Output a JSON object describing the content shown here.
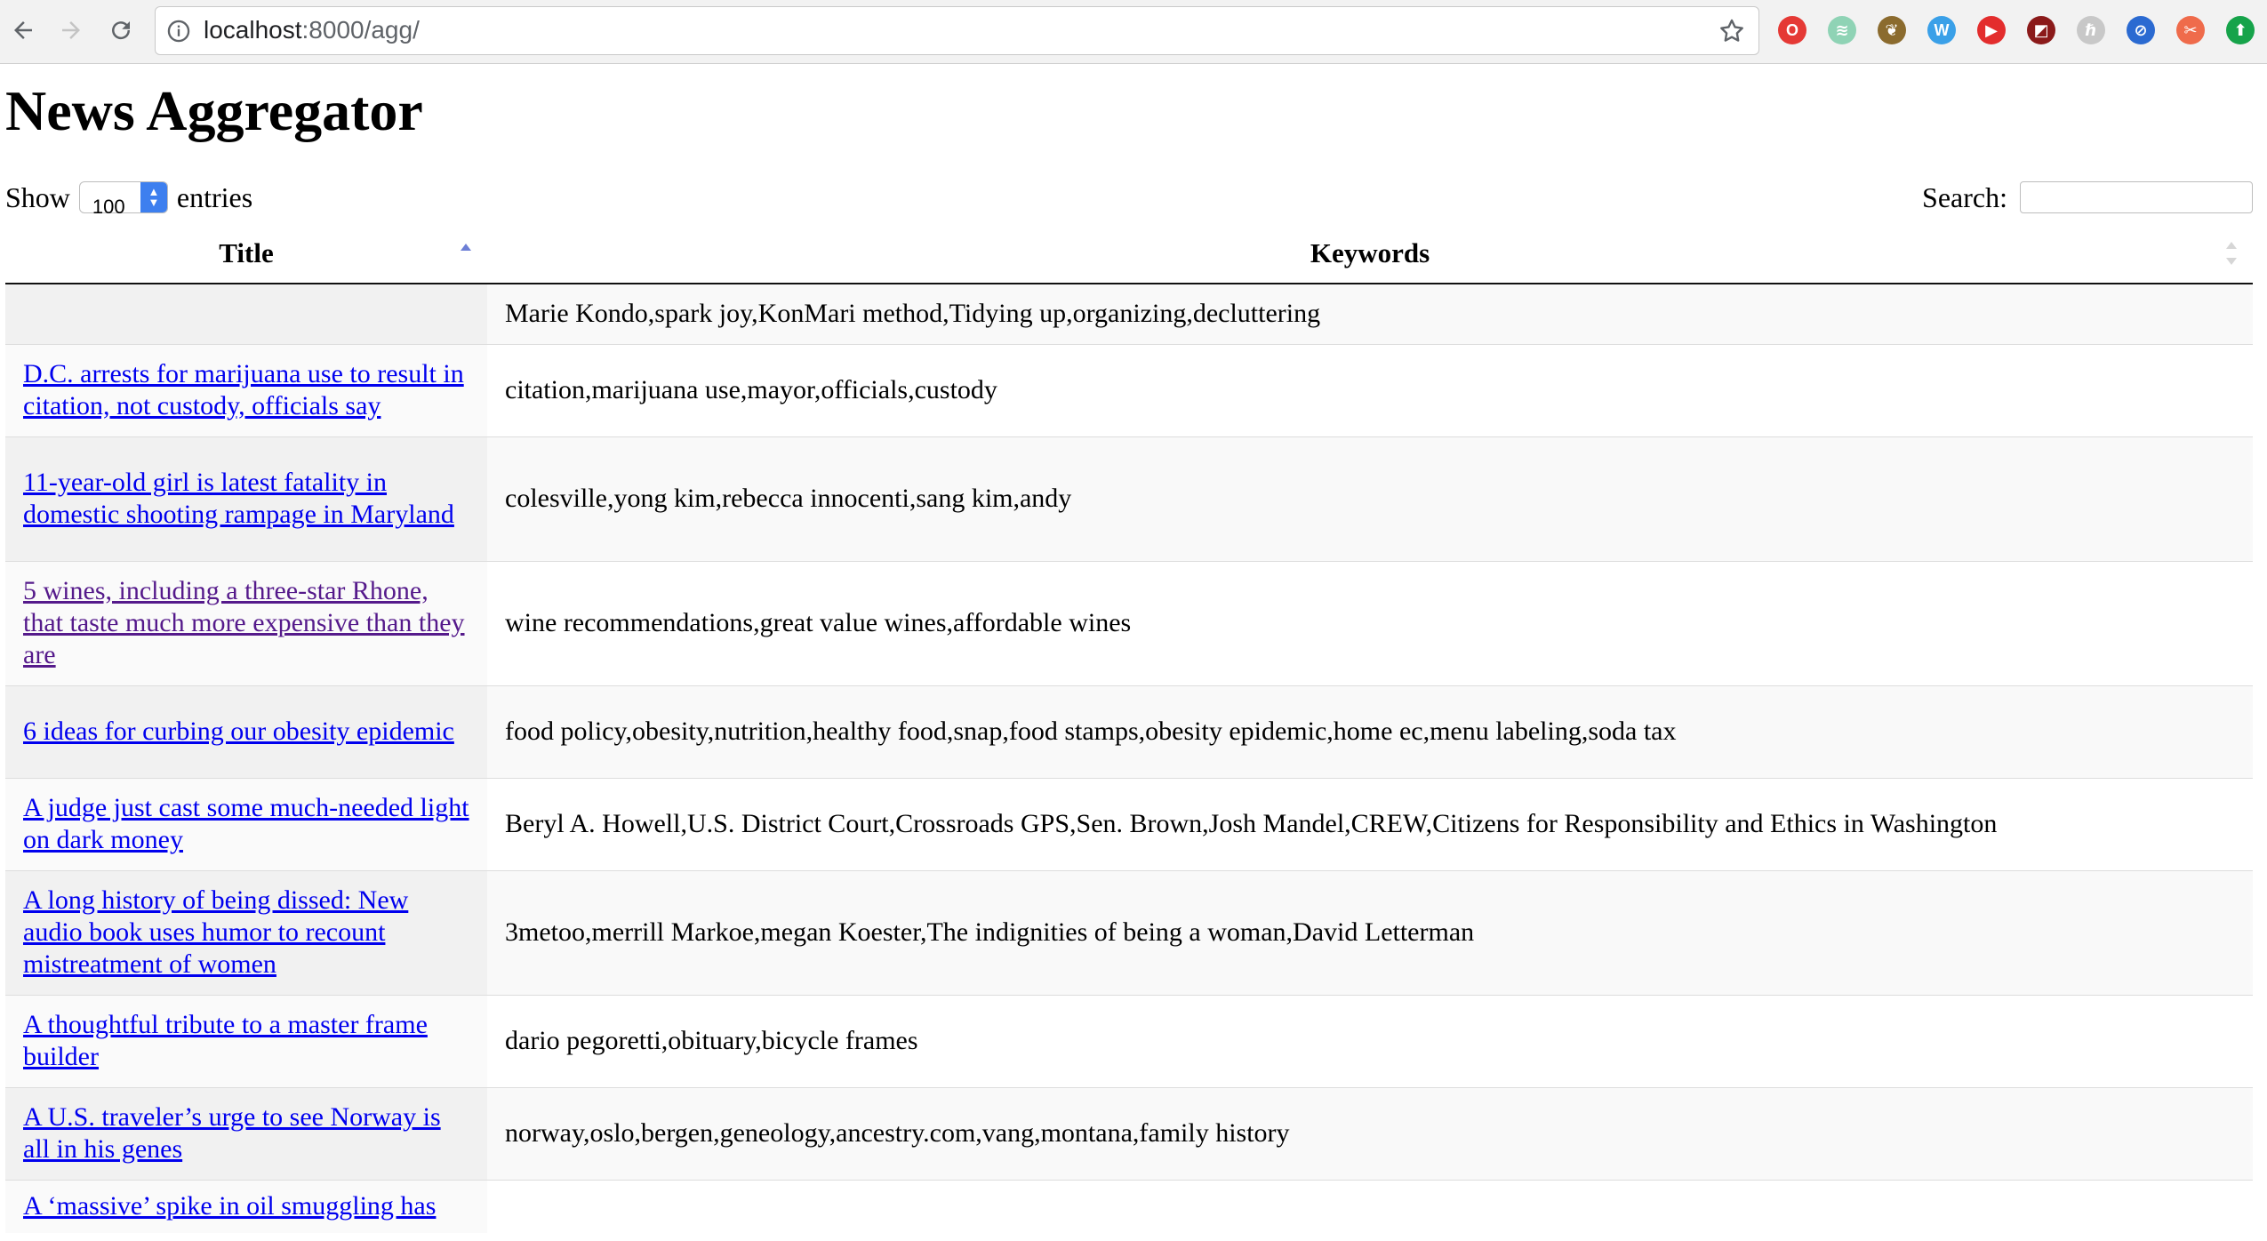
{
  "browser": {
    "url_host": "localhost",
    "url_rest": ":8000/agg/"
  },
  "page": {
    "heading": "News Aggregator",
    "length_prefix": "Show",
    "length_value": "100",
    "length_suffix": "entries",
    "search_label": "Search:"
  },
  "table": {
    "headers": {
      "title": "Title",
      "keywords": "Keywords"
    },
    "rows": [
      {
        "title": "",
        "keywords": "Marie Kondo,spark joy,KonMari method,Tidying up,organizing,decluttering"
      },
      {
        "title": "D.C. arrests for marijuana use to result in citation, not custody, officials say",
        "keywords": "citation,marijuana use,mayor,officials,custody"
      },
      {
        "title": "11-year-old girl is latest fatality in domestic shooting rampage in Maryland",
        "keywords": "colesville,yong kim,rebecca innocenti,sang kim,andy"
      },
      {
        "title": "5 wines, including a three-star Rhone, that taste much more expensive than they are",
        "keywords": "wine recommendations,great value wines,affordable wines",
        "visited": true
      },
      {
        "title": "6 ideas for curbing our obesity epidemic",
        "keywords": "food policy,obesity,nutrition,healthy food,snap,food stamps,obesity epidemic,home ec,menu labeling,soda tax"
      },
      {
        "title": "A judge just cast some much-needed light on dark money",
        "keywords": "Beryl A. Howell,U.S. District Court,Crossroads GPS,Sen. Brown,Josh Mandel,CREW,Citizens for Responsibility and Ethics in Washington"
      },
      {
        "title": "A long history of being dissed: New audio book uses humor to recount mistreatment of women",
        "keywords": "3metoo,merrill Markoe,megan Koester,The indignities of being a woman,David Letterman"
      },
      {
        "title": "A thoughtful tribute to a master frame builder",
        "keywords": "dario pegoretti,obituary,bicycle frames"
      },
      {
        "title": "A U.S. traveler’s urge to see Norway is all in his genes",
        "keywords": "norway,oslo,bergen,geneology,ancestry.com,vang,montana,family history"
      },
      {
        "title": "A ‘massive’ spike in oil smuggling has",
        "keywords": ""
      }
    ]
  },
  "extensions": [
    {
      "name": "opera-extension-icon",
      "color": "#e53935",
      "glyph": "O"
    },
    {
      "name": "audio-extension-icon",
      "color": "#8fd3b5",
      "glyph": "≋"
    },
    {
      "name": "plant-extension-icon",
      "color": "#8b6b2e",
      "glyph": "❦"
    },
    {
      "name": "w-extension-icon",
      "color": "#3aa0e8",
      "glyph": "W"
    },
    {
      "name": "youtube-extension-icon",
      "color": "#e32d2d",
      "glyph": "▶"
    },
    {
      "name": "image-extension-icon",
      "color": "#8b1a1a",
      "glyph": "◩"
    },
    {
      "name": "h-extension-icon",
      "color": "#c8c8c8",
      "glyph": "ℏ"
    },
    {
      "name": "block-extension-icon",
      "color": "#2b6ad1",
      "glyph": "⊘"
    },
    {
      "name": "tools-extension-icon",
      "color": "#ef6b4b",
      "glyph": "✂"
    },
    {
      "name": "upload-extension-icon",
      "color": "#16a34a",
      "glyph": "⬆"
    }
  ]
}
